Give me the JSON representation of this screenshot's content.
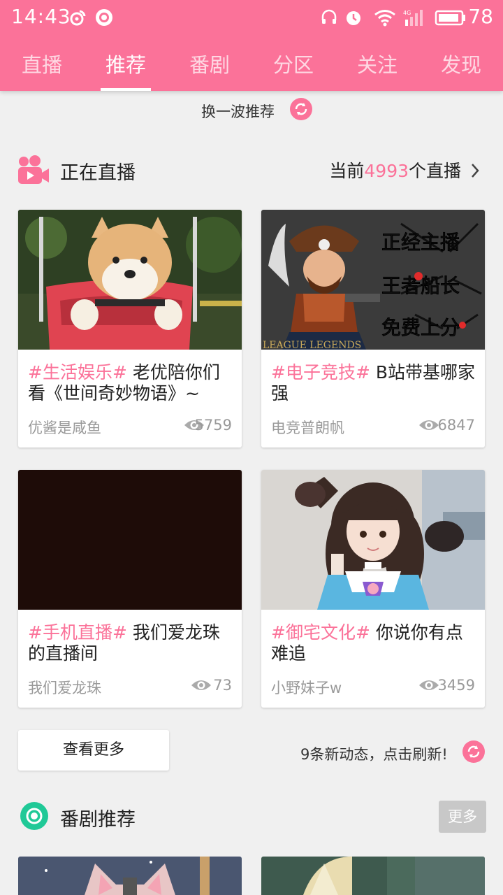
{
  "status": {
    "time": "14:43",
    "battery": "78",
    "signal_label": "4G"
  },
  "tabs": [
    "直播",
    "推荐",
    "番剧",
    "分区",
    "关注",
    "发现"
  ],
  "active_tab": "推荐",
  "refresh": {
    "label": "换一波推荐"
  },
  "live_section": {
    "title": "正在直播",
    "count_prefix": "当前",
    "count": "4993",
    "count_suffix": "个直播"
  },
  "live_cards": [
    {
      "tag": "#生活娱乐#",
      "title": " 老优陪你们看《世间奇妙物语》~",
      "user": "优酱是咸鱼",
      "views": "5759"
    },
    {
      "tag": "#电子竞技#",
      "title": " B站带基哪家强",
      "user": "电竞普朗帆",
      "views": "6847"
    },
    {
      "tag": "#手机直播#",
      "title": " 我们爱龙珠的直播间",
      "user": "我们爱龙珠",
      "views": "73"
    },
    {
      "tag": "#御宅文化#",
      "title": " 你说你有点难追",
      "user": "小野妹子w",
      "views": "3459"
    }
  ],
  "thumb_text": {
    "card2_lines": [
      "正经主播",
      "王者船长",
      "免费上分"
    ],
    "card2_logo": "LEAGUE LEGENDS"
  },
  "actions": {
    "see_more": "查看更多",
    "new_updates": "9条新动态，点击刷新!"
  },
  "bangumi_section": {
    "title": "番剧推荐",
    "more": "更多"
  },
  "colors": {
    "brand": "#fb7299",
    "bangumi_icon": "#20c997",
    "background": "#f0f0f0"
  }
}
